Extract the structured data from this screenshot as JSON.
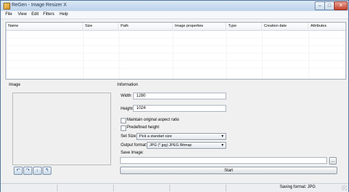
{
  "window": {
    "title": "ReGen - Image Resizer X",
    "min_label": "–",
    "max_label": "□",
    "close_label": "✕"
  },
  "menu": [
    "File",
    "View",
    "Edit",
    "Filters",
    "Help"
  ],
  "file_list": {
    "columns": [
      "Name",
      "Size",
      "Path",
      "Image properties",
      "Type",
      "Creation date",
      "Attributes"
    ],
    "rows": []
  },
  "image_section": {
    "label": "Image",
    "tools": [
      "rotate-left-icon",
      "rotate-right-icon",
      "flip-icon",
      "undo-icon"
    ],
    "tool_glyphs": [
      "↶",
      "↷",
      "↓",
      "↰"
    ]
  },
  "information": {
    "label": "Information",
    "width_label": "Width",
    "width_value": "1280",
    "height_label": "Height",
    "height_value": "1024",
    "maintain_ratio_label": "Maintain original aspect ratio",
    "maintain_ratio_checked": false,
    "predefined_height_label": "Predefined height",
    "predefined_height_checked": false,
    "set_size_label": "Set Size:",
    "set_size_value": "Pick a standart size",
    "output_format_label": "Output format:",
    "output_format_value": "JPG (*.jpg) JPEG Bitmap",
    "save_image_label": "Save Image:",
    "save_image_value": "",
    "browse_label": "...",
    "start_label": "Start"
  },
  "status": {
    "text": "Saving format: JPG"
  },
  "colors": {
    "title_bar": "#c9dcef",
    "close_button": "#c4422d",
    "panel_bg": "#f0f0f0"
  }
}
